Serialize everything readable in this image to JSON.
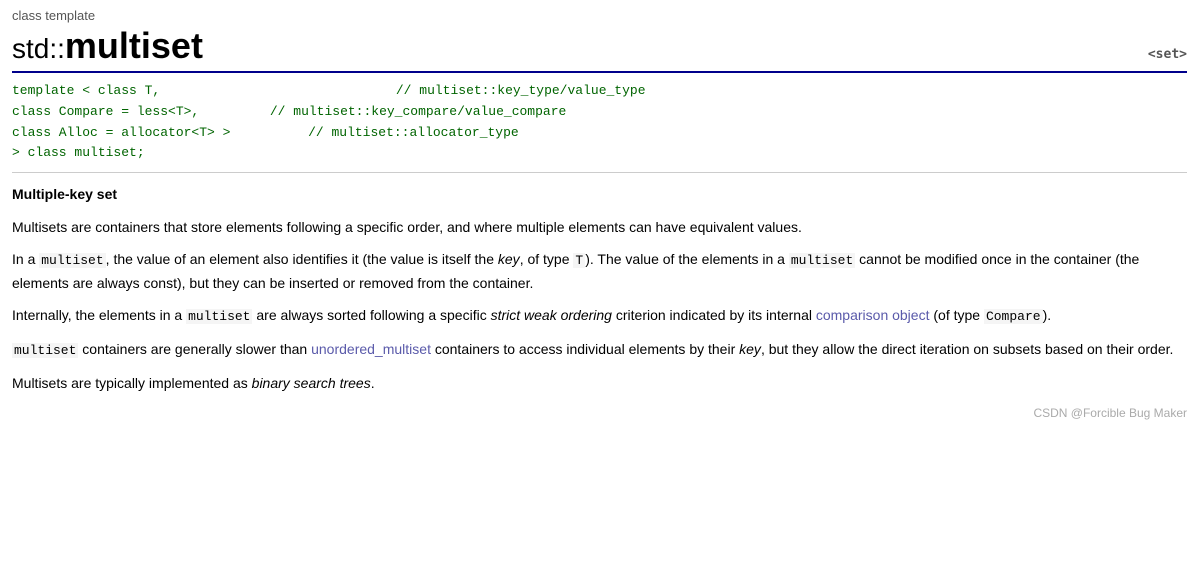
{
  "header": {
    "class_label": "class template",
    "namespace": "std::",
    "title": "multiset",
    "set_link": "<set>"
  },
  "code": {
    "line1_kw": "template < class T,",
    "line1_comment": "// multiset::key_type/value_type",
    "line2_kw": "        class Compare = less<T>,",
    "line2_comment": "// multiset::key_compare/value_compare",
    "line3_kw": "        class Alloc = allocator<T> >",
    "line3_comment": "// multiset::allocator_type",
    "line4_kw": "        > class multiset;"
  },
  "content": {
    "heading": "Multiple-key set",
    "para1": "Multisets are containers that store elements following a specific order, and where multiple elements can have equivalent values.",
    "para2_parts": {
      "before": "In a ",
      "code1": "multiset",
      "middle1": ", the value of an element also identifies it (the value is itself the ",
      "em1": "key",
      "middle2": ", of type ",
      "code2": "T",
      "middle3": "). The value of the elements in a ",
      "code3": "multiset",
      "after": " cannot be modified once in the container (the elements are always const), but they can be inserted or removed from the container."
    },
    "para3_parts": {
      "before": "Internally, the elements in a ",
      "code1": "multiset",
      "middle1": " are always sorted following a specific ",
      "em1": "strict weak ordering",
      "middle2": " criterion indicated by its internal ",
      "link1": "comparison object",
      "middle3": " (of type ",
      "code2": "Compare",
      "after": ")."
    },
    "para4_parts": {
      "code1": "multiset",
      "before": " containers are generally slower than ",
      "link1": "unordered_multiset",
      "middle1": " containers to access individual elements by their ",
      "em1": "key",
      "after": ", but they allow the direct iteration on subsets based on their order."
    },
    "para5_parts": {
      "before": "Multisets are typically implemented as ",
      "em1": "binary search trees",
      "after": "."
    },
    "watermark": "CSDN @Forcible Bug Maker"
  }
}
